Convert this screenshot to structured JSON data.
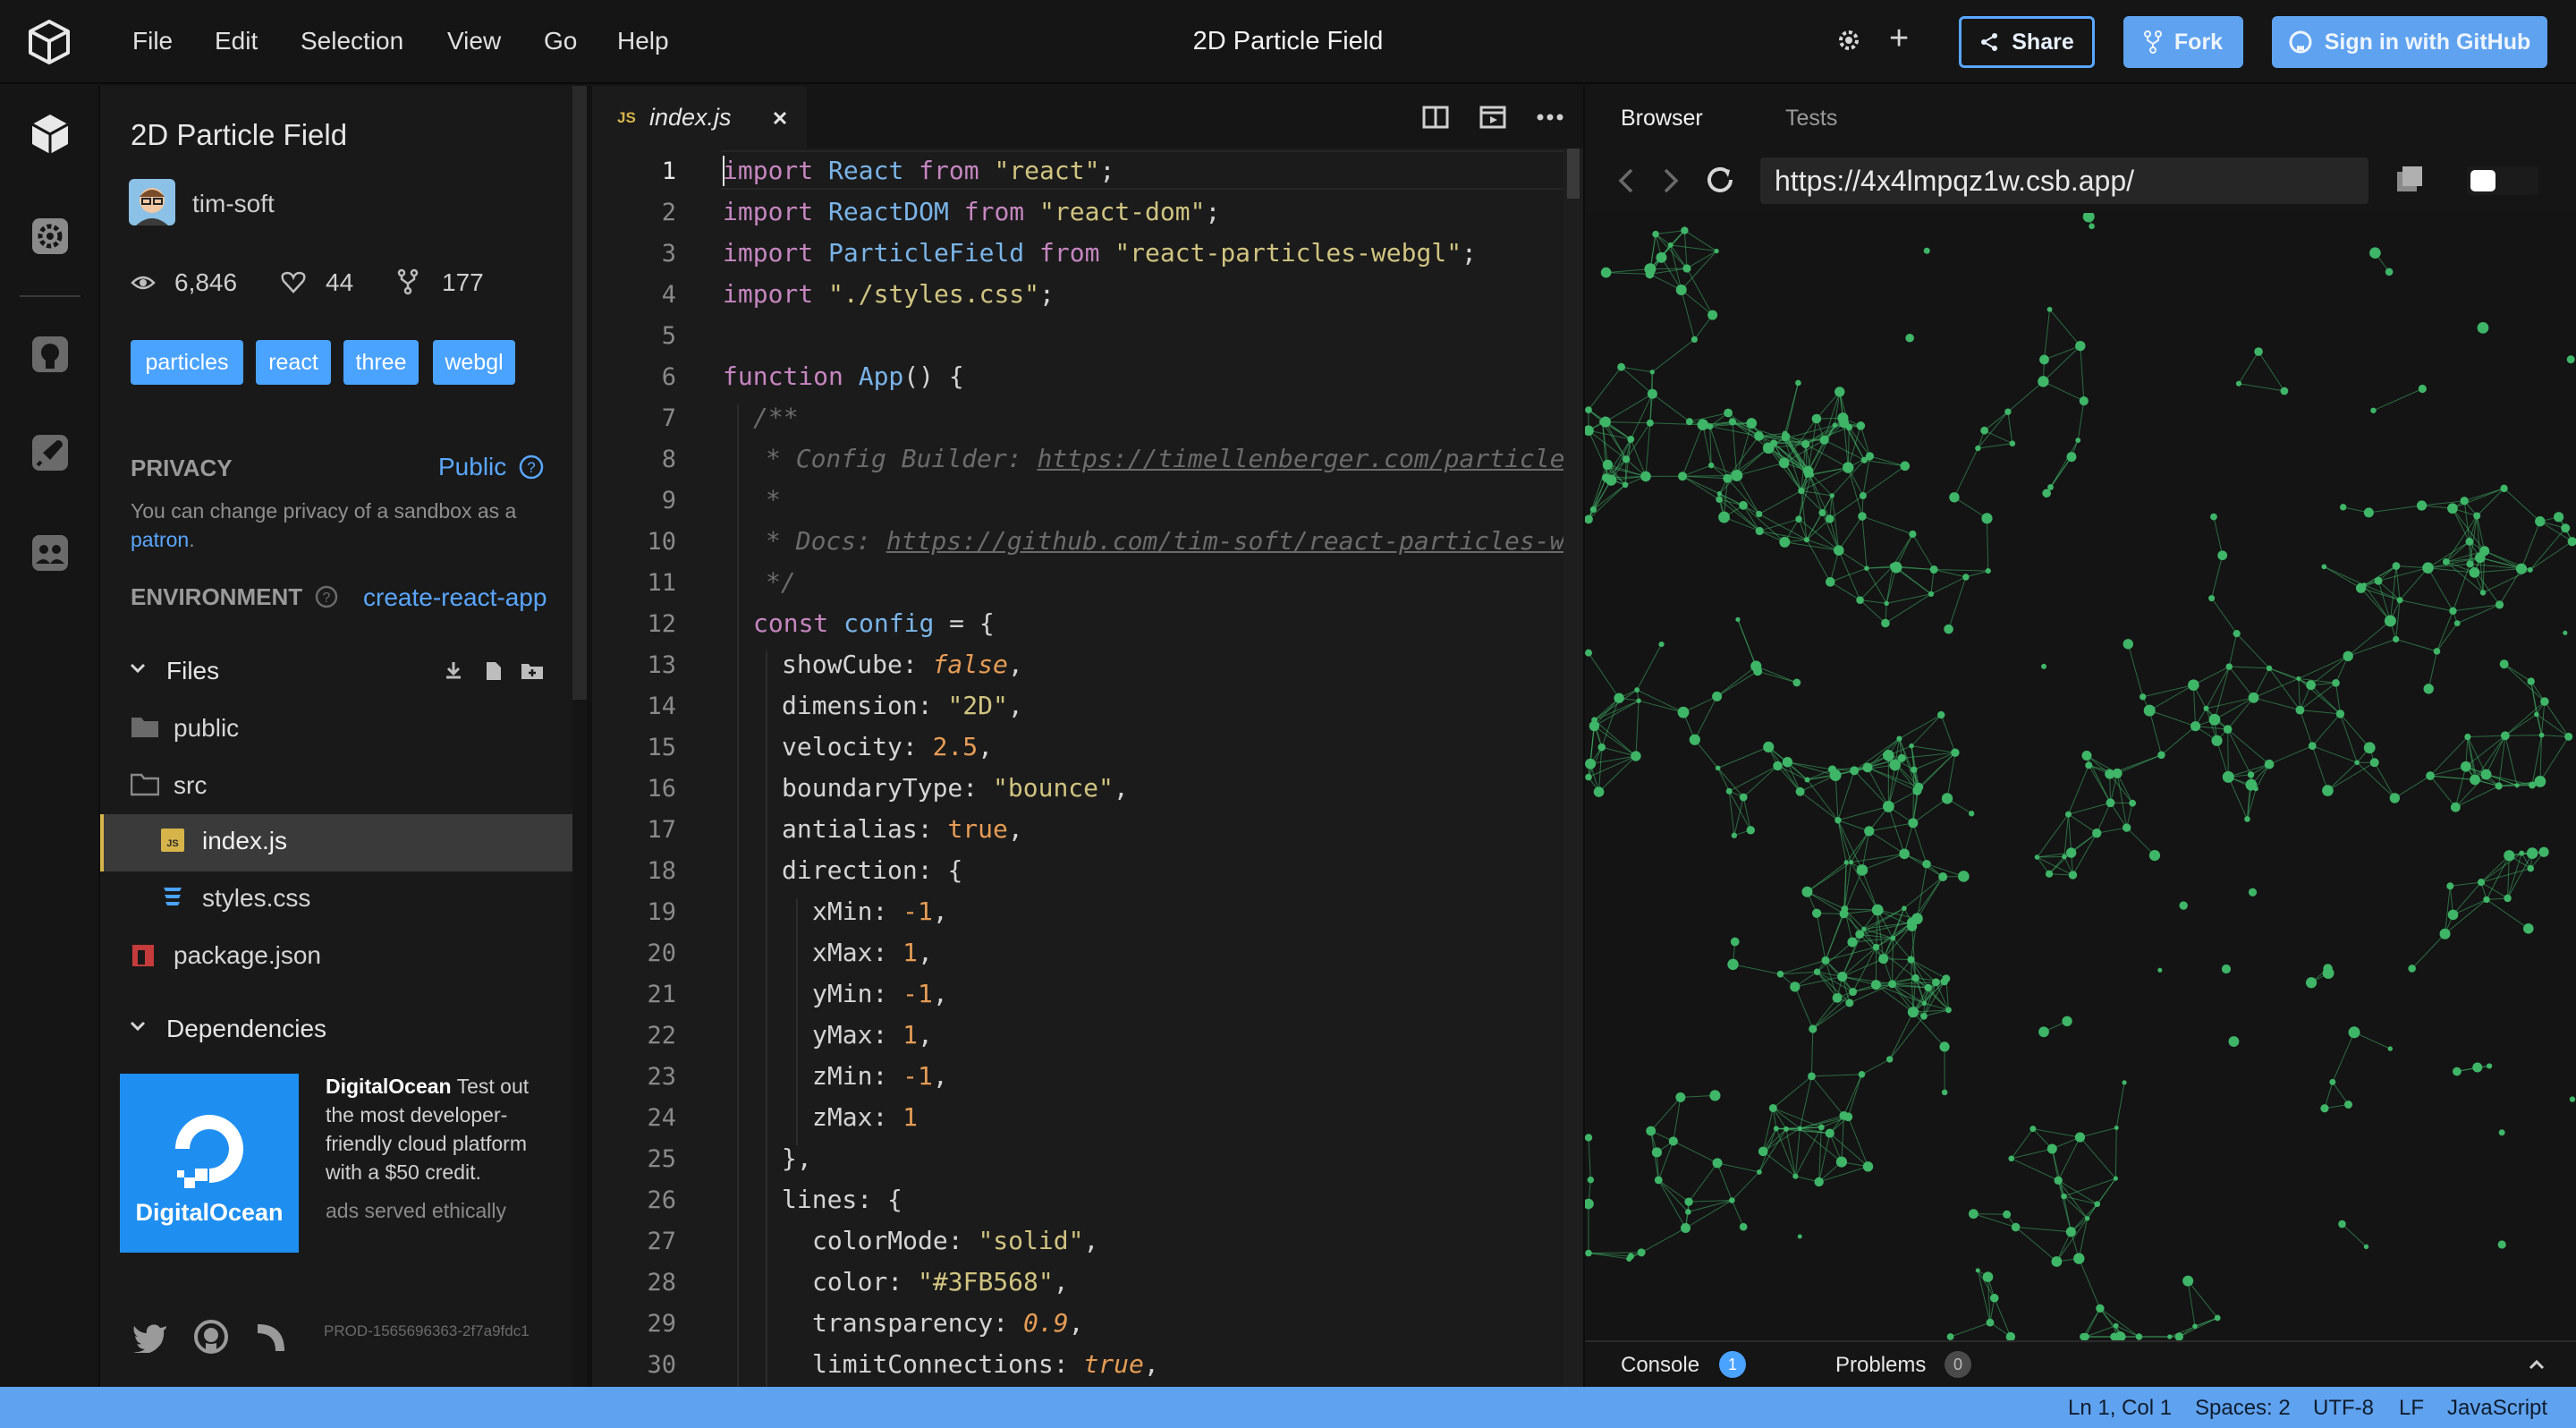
{
  "menu": {
    "items": [
      "File",
      "Edit",
      "Selection",
      "View",
      "Go",
      "Help"
    ],
    "title": "2D Particle Field",
    "share_label": "Share",
    "fork_label": "Fork",
    "github_label": "Sign in with GitHub"
  },
  "sidebar": {
    "sandbox_title": "2D Particle Field",
    "author": "tim-soft",
    "stats": {
      "views": "6,846",
      "likes": "44",
      "forks": "177"
    },
    "tags": [
      "particles",
      "react",
      "three",
      "webgl"
    ],
    "privacy": {
      "heading": "PRIVACY",
      "value": "Public",
      "note": "You can change privacy of a sandbox as a",
      "note_link": "patron",
      "note_end": "."
    },
    "environment": {
      "heading": "ENVIRONMENT",
      "value": "create-react-app"
    },
    "files_heading": "Files",
    "files": [
      {
        "name": "public",
        "icon": "folder-icon"
      },
      {
        "name": "src",
        "icon": "folder-open-icon"
      },
      {
        "name": "index.js",
        "icon": "js-file-icon",
        "active": true
      },
      {
        "name": "styles.css",
        "icon": "css-file-icon"
      },
      {
        "name": "package.json",
        "icon": "npm-file-icon"
      }
    ],
    "dependencies_heading": "Dependencies",
    "ad": {
      "brand": "DigitalOcean",
      "logo_text": "DigitalOcean",
      "text": "Test out the most developer-friendly cloud platform with a $50 credit.",
      "served": "ads served ethically"
    },
    "build_id": "PROD-1565696363-2f7a9fdc1"
  },
  "editor": {
    "tab_label": "index.js",
    "tab_badge": "JS",
    "line_numbers": [
      "1",
      "2",
      "3",
      "4",
      "5",
      "6",
      "7",
      "8",
      "9",
      "10",
      "11",
      "12",
      "13",
      "14",
      "15",
      "16",
      "17",
      "18",
      "19",
      "20",
      "21",
      "22",
      "23",
      "24",
      "25",
      "26",
      "27",
      "28",
      "29",
      "30"
    ]
  },
  "code": {
    "l1_kw": "import",
    "l1_id": " React ",
    "l1_from": "from",
    "l1_str": " \"react\"",
    "l1_end": ";",
    "l2_kw": "import",
    "l2_id": " ReactDOM ",
    "l2_from": "from",
    "l2_str": " \"react-dom\"",
    "l2_end": ";",
    "l3_kw": "import",
    "l3_id": " ParticleField ",
    "l3_from": "from",
    "l3_str": " \"react-particles-webgl\"",
    "l3_end": ";",
    "l4_kw": "import",
    "l4_str": " \"./styles.css\"",
    "l4_end": ";",
    "l6_kw": "function",
    "l6_fn": " App",
    "l6_end": "() {",
    "l7": "/**",
    "l8_a": "* Config Builder: ",
    "l8_link": "https://timellenberger.com/particles",
    "l9": "*",
    "l10_a": "* Docs: ",
    "l10_link": "https://github.com/tim-soft/react-particles-webgl",
    "l11": "*/",
    "l12_kw": "const",
    "l12_var": " config",
    "l12_end": " = {",
    "l13_p": "showCube",
    "l13_v": "false",
    "l14_p": "dimension",
    "l14_v": "\"2D\"",
    "l15_p": "velocity",
    "l15_v": "2.5",
    "l16_p": "boundaryType",
    "l16_v": "\"bounce\"",
    "l17_p": "antialias",
    "l17_v": "true",
    "l18_p": "direction",
    "l18_v": "{",
    "l19_p": "xMin",
    "l19_v": "-1",
    "l20_p": "xMax",
    "l20_v": "1",
    "l21_p": "yMin",
    "l21_v": "-1",
    "l22_p": "yMax",
    "l22_v": "1",
    "l23_p": "zMin",
    "l23_v": "-1",
    "l24_p": "zMax",
    "l24_v": "1",
    "l25": "},",
    "l26_p": "lines",
    "l26_v": "{",
    "l27_p": "colorMode",
    "l27_v": "\"solid\"",
    "l28_p": "color",
    "l28_v": "\"#3FB568\"",
    "l29_p": "transparency",
    "l29_v": "0.9",
    "l30_p": "limitConnections",
    "l30_v": "true"
  },
  "preview": {
    "tabs": [
      "Browser",
      "Tests"
    ],
    "url": "https://4x4lmpqz1w.csb.app/",
    "console_label": "Console",
    "console_count": "1",
    "problems_label": "Problems",
    "problems_count": "0",
    "particle_color": "#3FB568"
  },
  "status": {
    "position": "Ln 1, Col 1",
    "spaces": "Spaces: 2",
    "encoding": "UTF-8",
    "eol": "LF",
    "language": "JavaScript"
  },
  "colors": {
    "accent": "#5fa2ef",
    "tag": "#4aa3ff",
    "active_file_border": "#d7b44a",
    "ad_bg": "#1e8ff0"
  }
}
